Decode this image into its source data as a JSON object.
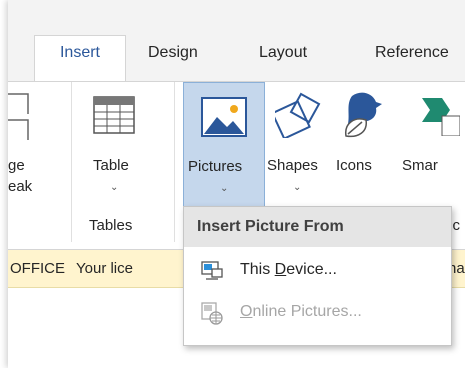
{
  "tabs": {
    "insert": "Insert",
    "design": "Design",
    "layout": "Layout",
    "references": "Reference"
  },
  "ribbon": {
    "page_break_line1": "ge",
    "page_break_line2": "eak",
    "table_label": "Table",
    "pictures_label": "Pictures",
    "shapes_label": "Shapes",
    "icons_label": "Icons",
    "smartart_label": "Smar",
    "group_tables": "Tables",
    "group_partial": "tic"
  },
  "infobar": {
    "brand": "OFFICE",
    "message": "Your lice",
    "message_tail": "na"
  },
  "dropdown": {
    "header": "Insert Picture From",
    "this_device_pre": "This ",
    "this_device_accel": "D",
    "this_device_post": "evice...",
    "online_accel": "O",
    "online_post": "nline Pictures..."
  },
  "colors": {
    "accent": "#2b579a",
    "selected_bg": "#c5d7ec",
    "infobar_bg": "#fff4ce"
  }
}
